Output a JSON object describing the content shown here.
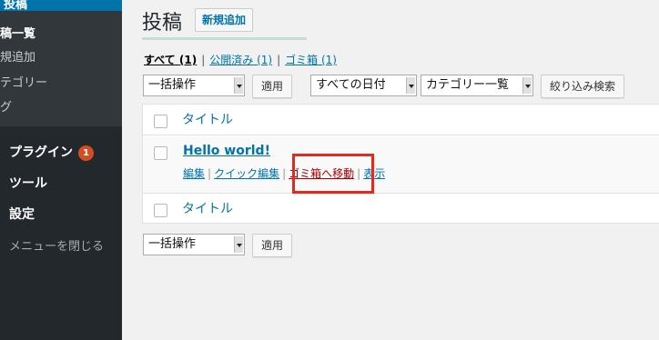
{
  "sidebar": {
    "active_tab_label": "投稿",
    "submenu": [
      {
        "label": "稿一覧",
        "current": true
      },
      {
        "label": "規追加",
        "current": false
      },
      {
        "label": "テゴリー",
        "current": false
      },
      {
        "label": "グ",
        "current": false
      }
    ],
    "menu": [
      {
        "label": "プラグイン",
        "badge": "1"
      },
      {
        "label": "ツール"
      },
      {
        "label": "設定"
      }
    ],
    "collapse_label": "メニューを閉じる"
  },
  "header": {
    "title": "投稿",
    "add_new_label": "新規追加"
  },
  "filters": {
    "all": {
      "label": "すべて",
      "count": "(1)"
    },
    "published": {
      "label": "公開済み",
      "count": "(1)"
    },
    "trash": {
      "label": "ゴミ箱",
      "count": "(1)"
    },
    "separator": "|"
  },
  "toolbar_top": {
    "bulk_action": "一括操作",
    "apply": "適用",
    "date_filter": "すべての日付",
    "category_filter": "カテゴリー一覧",
    "filter_button": "絞り込み検索"
  },
  "table": {
    "column_title": "タイトル",
    "posts": [
      {
        "title": "Hello world!",
        "actions": {
          "edit": "編集",
          "quick_edit": "クイック編集",
          "trash": "ゴミ箱へ移動",
          "view": "表示"
        }
      }
    ]
  },
  "toolbar_bottom": {
    "bulk_action": "一括操作",
    "apply": "適用"
  },
  "colors": {
    "sidebar_bg": "#23282d",
    "active_blue": "#0073aa",
    "highlight_red": "#e8271d",
    "badge_orange": "#d54e21"
  }
}
